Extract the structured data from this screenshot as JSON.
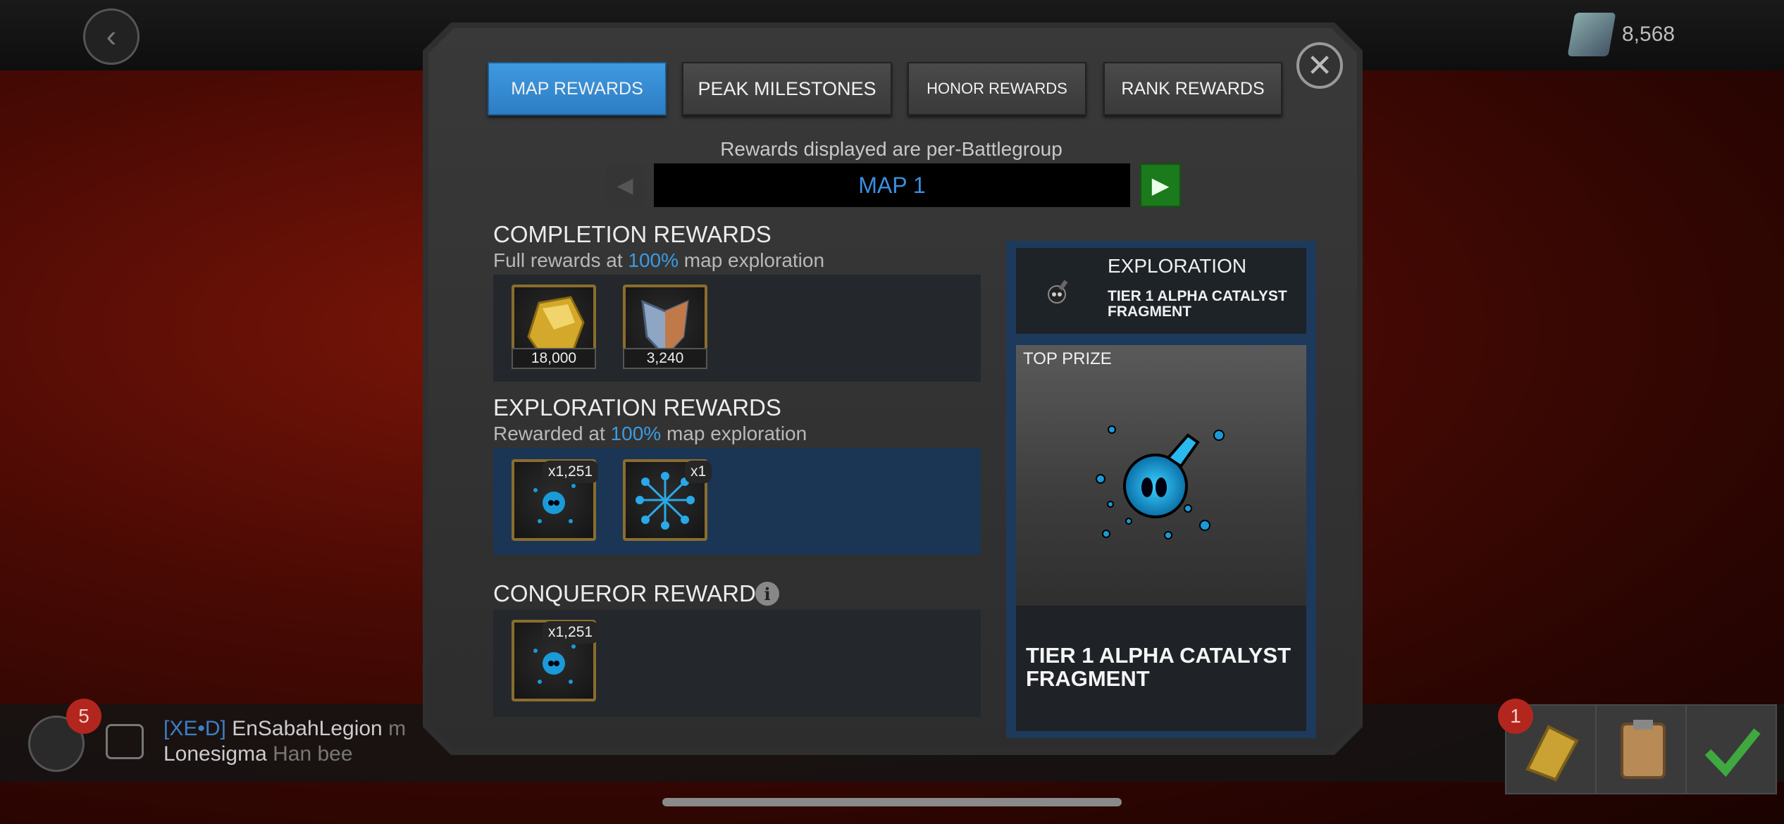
{
  "game_background": {
    "units_value": "8,568",
    "chat": {
      "alliance_badge": "5",
      "line1_tag": "[XE•D]",
      "line1_name": "EnSabahLegion",
      "line1_rest": "m",
      "line2_name": "Lonesigma",
      "line2_rest": "Han bee"
    },
    "quest_badge": "1"
  },
  "modal": {
    "tabs": [
      {
        "label": "MAP REWARDS",
        "active": true
      },
      {
        "label": "PEAK MILESTONES",
        "active": false
      },
      {
        "label": "HONOR REWARDS",
        "active": false
      },
      {
        "label": "RANK REWARDS",
        "active": false
      }
    ],
    "note": "Rewards displayed are per-Battlegroup",
    "map_selector": {
      "value": "MAP 1",
      "prev_glyph": "◀",
      "next_glyph": "▶"
    },
    "completion": {
      "title": "COMPLETION REWARDS",
      "sub_pre": "Full rewards at ",
      "sub_pct": "100%",
      "sub_post": " map exploration",
      "items": [
        {
          "icon": "gold-icon",
          "qty": "18,000"
        },
        {
          "icon": "battlechip-icon",
          "qty": "3,240"
        }
      ]
    },
    "exploration": {
      "title": "EXPLORATION REWARDS",
      "sub_pre": "Rewarded at ",
      "sub_pct": "100%",
      "sub_post": " map exploration",
      "items": [
        {
          "icon": "alpha-catalyst-fragment-icon",
          "count": "x1,251"
        },
        {
          "icon": "crystal-shard-network-icon",
          "count": "x1"
        }
      ]
    },
    "conqueror": {
      "title": "CONQUEROR REWARDS",
      "items": [
        {
          "icon": "alpha-catalyst-fragment-icon",
          "count": "x1,251"
        }
      ]
    },
    "side_card": {
      "header_title": "EXPLORATION",
      "header_item": "TIER 1 ALPHA CATALYST FRAGMENT",
      "top_prize_label": "TOP PRIZE",
      "prize_name": "TIER 1 ALPHA CATALYST FRAGMENT"
    }
  }
}
